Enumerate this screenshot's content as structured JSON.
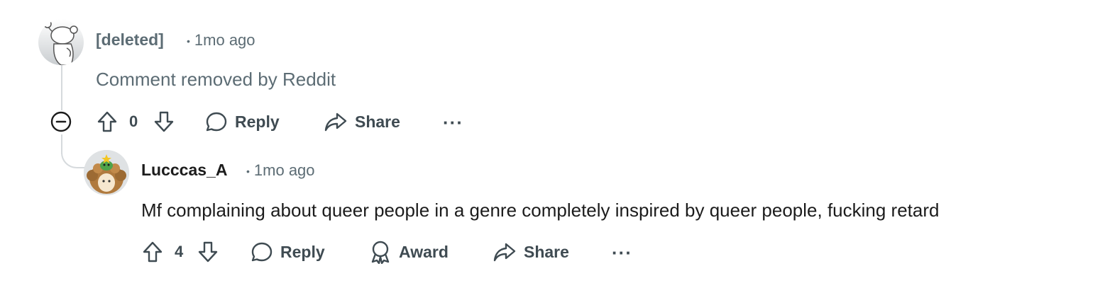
{
  "comments": [
    {
      "author": "[deleted]",
      "time": "1mo ago",
      "text": "Comment removed by Reddit",
      "votes": "0",
      "actions": {
        "reply": "Reply",
        "share": "Share",
        "more": "···"
      }
    },
    {
      "author": "Lucccas_A",
      "time": "1mo ago",
      "text": "Mf complaining about queer people in a genre completely inspired by queer people, fucking retard",
      "votes": "4",
      "actions": {
        "reply": "Reply",
        "award": "Award",
        "share": "Share",
        "more": "···"
      }
    }
  ],
  "separator": "•",
  "icons": {
    "deleted_avatar": "snoo-avatar-icon",
    "user_avatar": "user-avatar-icon",
    "collapse": "collapse-thread-icon",
    "upvote": "upvote-arrow-icon",
    "downvote": "downvote-arrow-icon",
    "reply": "speech-bubble-icon",
    "award": "award-ribbon-icon",
    "share": "share-arrow-icon"
  },
  "colors": {
    "text_primary": "#1c1c1c",
    "text_secondary": "#5c6c74",
    "deleted_author": "#5c6c74",
    "action": "#3f4b52",
    "thread_line": "#d6dadd"
  }
}
